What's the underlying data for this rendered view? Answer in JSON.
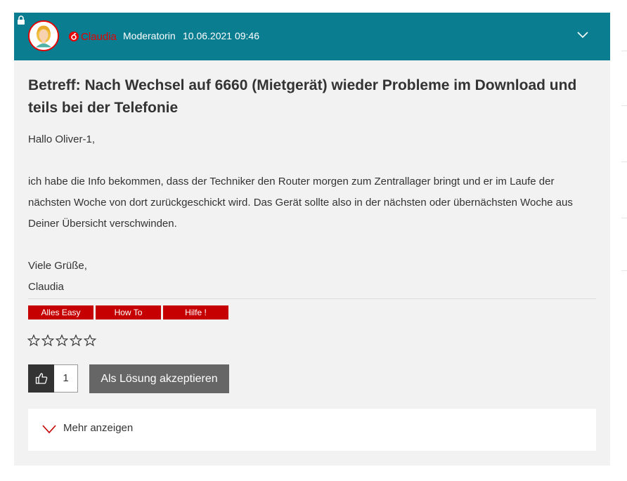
{
  "post": {
    "author": "Claudia",
    "role": "Moderatorin",
    "datetime": "10.06.2021 09:46",
    "subject": "Betreff: Nach Wechsel auf 6660 (Mietgerät) wieder Probleme im Download und teils bei der Telefonie",
    "body": {
      "greeting": "Hallo Oliver-1,",
      "line1": "ich habe die Info bekommen, dass der Techniker den Router morgen zum Zentrallager bringt und er im Laufe der",
      "line2": "nächsten Woche von dort zurückgeschickt wird. Das Gerät sollte also in der nächsten oder übernächsten Woche aus",
      "line3": "Deiner Übersicht verschwinden.",
      "closing": "Viele Grüße,",
      "signature": "Claudia"
    },
    "tags": [
      "Alles Easy",
      "How To",
      "Hilfe !"
    ],
    "rating": {
      "value": 0,
      "max": 5
    },
    "kudos_count": "1",
    "accept_solution_label": "Als Lösung akzeptieren",
    "show_more_label": "Mehr anzeigen"
  },
  "colors": {
    "header_bg": "#0b7d91",
    "brand_red": "#e60000",
    "tag_bg": "#c60000",
    "post_bg": "#f2f2f2"
  },
  "icons": [
    "lock-icon",
    "vodafone-logo-icon",
    "chevron-down-icon",
    "star-outline-icon",
    "thumbs-up-icon"
  ]
}
